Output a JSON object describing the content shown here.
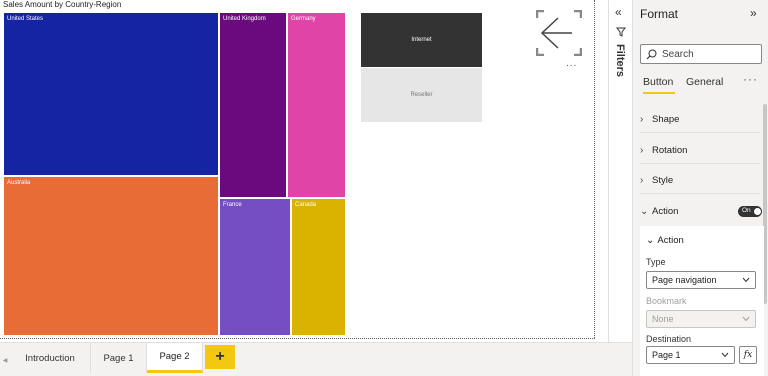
{
  "canvas": {
    "chart_title": "Sales Amount by Country-Region",
    "treemap": [
      {
        "label": "United States",
        "color": "#1524a3"
      },
      {
        "label": "Australia",
        "color": "#e86c36"
      },
      {
        "label": "United Kingdom",
        "color": "#6b0a7e"
      },
      {
        "label": "Germany",
        "color": "#e044a7"
      },
      {
        "label": "France",
        "color": "#744ec2"
      },
      {
        "label": "Canada",
        "color": "#d9b300"
      }
    ],
    "nav_buttons": {
      "internet": "Internet",
      "reseller": "Reseller"
    },
    "back_button_icon": "back-arrow-icon",
    "more_options": "..."
  },
  "page_tabs": {
    "tabs": [
      "Introduction",
      "Page 1",
      "Page 2"
    ],
    "active": "Page 2",
    "add_label": "+"
  },
  "filters": {
    "label": "Filters",
    "collapse_icon": "double-chevron-left-icon"
  },
  "format_pane": {
    "title": "Format",
    "expand_icon": "double-chevron-right-icon",
    "search_placeholder": "Search",
    "tabs": {
      "button": "Button",
      "general": "General",
      "more": "···"
    },
    "sections": {
      "shape": "Shape",
      "rotation": "Rotation",
      "style": "Style",
      "action": "Action"
    },
    "action_toggle": "On",
    "action_card": {
      "heading": "Action",
      "type_label": "Type",
      "type_value": "Page navigation",
      "bookmark_label": "Bookmark",
      "bookmark_value": "None",
      "destination_label": "Destination",
      "destination_value": "Page 1",
      "fx_label": "fx"
    },
    "accent_color": "#f2c811"
  }
}
